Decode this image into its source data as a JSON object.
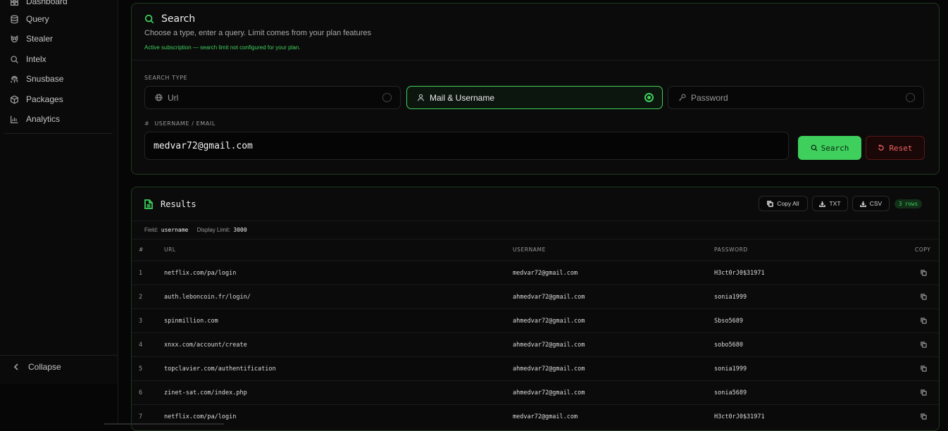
{
  "sidebar": {
    "items": [
      {
        "label": "Dashboard",
        "icon": "dashboard-icon"
      },
      {
        "label": "Query",
        "icon": "database-icon"
      },
      {
        "label": "Stealer",
        "icon": "stealer-icon"
      },
      {
        "label": "Intelx",
        "icon": "search-icon"
      },
      {
        "label": "Snusbase",
        "icon": "fingerprint-icon"
      },
      {
        "label": "Packages",
        "icon": "package-icon"
      },
      {
        "label": "Analytics",
        "icon": "chart-icon"
      }
    ],
    "collapse_label": "Collapse"
  },
  "search": {
    "title": "Search",
    "subtitle": "Choose a type, enter a query. Limit comes from your plan features",
    "note": "Active subscription — search limit not configured for your plan.",
    "type_label": "SEARCH TYPE",
    "types": [
      {
        "label": "Url",
        "selected": false
      },
      {
        "label": "Mail & Username",
        "selected": true
      },
      {
        "label": "Password",
        "selected": false
      }
    ],
    "field_label": "USERNAME / EMAIL",
    "query_value": "medvar72@gmail.com",
    "search_button": "Search",
    "reset_button": "Reset"
  },
  "results": {
    "title": "Results",
    "copy_all": "Copy All",
    "txt": "TXT",
    "csv": "CSV",
    "rows_badge": "3 rows",
    "field_label": "Field:",
    "field_value": "username",
    "limit_label": "Display Limit:",
    "limit_value": "3000",
    "columns": [
      "#",
      "URL",
      "USERNAME",
      "PASSWORD",
      "COPY"
    ],
    "rows": [
      {
        "n": "1",
        "url": "netflix.com/pa/login",
        "username": "medvar72@gmail.com",
        "password": "H3ct0rJ0$31971"
      },
      {
        "n": "2",
        "url": "auth.leboncoin.fr/login/",
        "username": "ahmedvar72@gmail.com",
        "password": "sonia1999"
      },
      {
        "n": "3",
        "url": "spinmillion.com",
        "username": "ahmedvar72@gmail.com",
        "password": "Sbso5689"
      },
      {
        "n": "4",
        "url": "xnxx.com/account/create",
        "username": "ahmedvar72@gmail.com",
        "password": "sobo5680"
      },
      {
        "n": "5",
        "url": "topclavier.com/authentification",
        "username": "ahmedvar72@gmail.com",
        "password": "sonia1999"
      },
      {
        "n": "6",
        "url": "zinet-sat.com/index.php",
        "username": "ahmedvar72@gmail.com",
        "password": "sonia5689"
      },
      {
        "n": "7",
        "url": "netflix.com/pa/login",
        "username": "medvar72@gmail.com",
        "password": "H3ct0rJ0$31971"
      }
    ]
  },
  "colors": {
    "accent": "#3ecf5c",
    "danger": "#f06262",
    "background": "#060606"
  }
}
